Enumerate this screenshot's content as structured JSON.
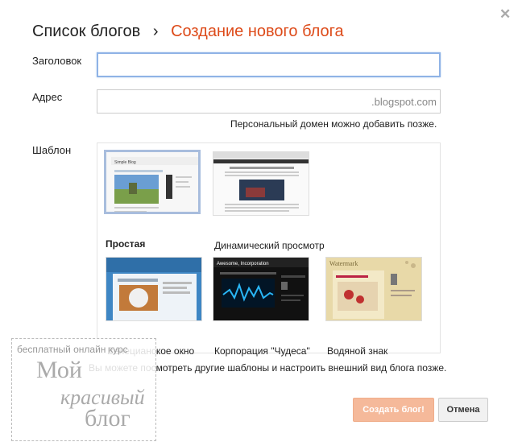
{
  "dialog": {
    "close_icon": "✕",
    "breadcrumb": {
      "parent": "Список блогов",
      "separator": "›",
      "current": "Создание нового блога"
    },
    "title_field": {
      "label": "Заголовок",
      "value": ""
    },
    "address_field": {
      "label": "Адрес",
      "value": "",
      "suffix": ".blogspot.com",
      "hint": "Персональный домен можно добавить позже."
    },
    "template": {
      "label": "Шаблон",
      "items": [
        {
          "name": "Простая",
          "selected": true
        },
        {
          "name": "Динамический просмотр",
          "selected": false
        },
        {
          "name": "Венецианское окно",
          "selected": false
        },
        {
          "name": "Корпорация \"Чудеса\"",
          "selected": false
        },
        {
          "name": "Водяной знак",
          "selected": false
        }
      ],
      "note": "Вы можете посмотреть другие шаблоны и настроить внешний вид блога позже."
    },
    "buttons": {
      "create": "Создать блог!",
      "cancel": "Отмена"
    },
    "colors": {
      "accent": "#dd4b1a",
      "primary_button": "#f5b99a",
      "focus_border": "#8fb3e6"
    }
  },
  "watermark": {
    "line1": "бесплатный онлайн курс",
    "line2": "Мой",
    "line3": "красивый",
    "line4": "блог"
  }
}
